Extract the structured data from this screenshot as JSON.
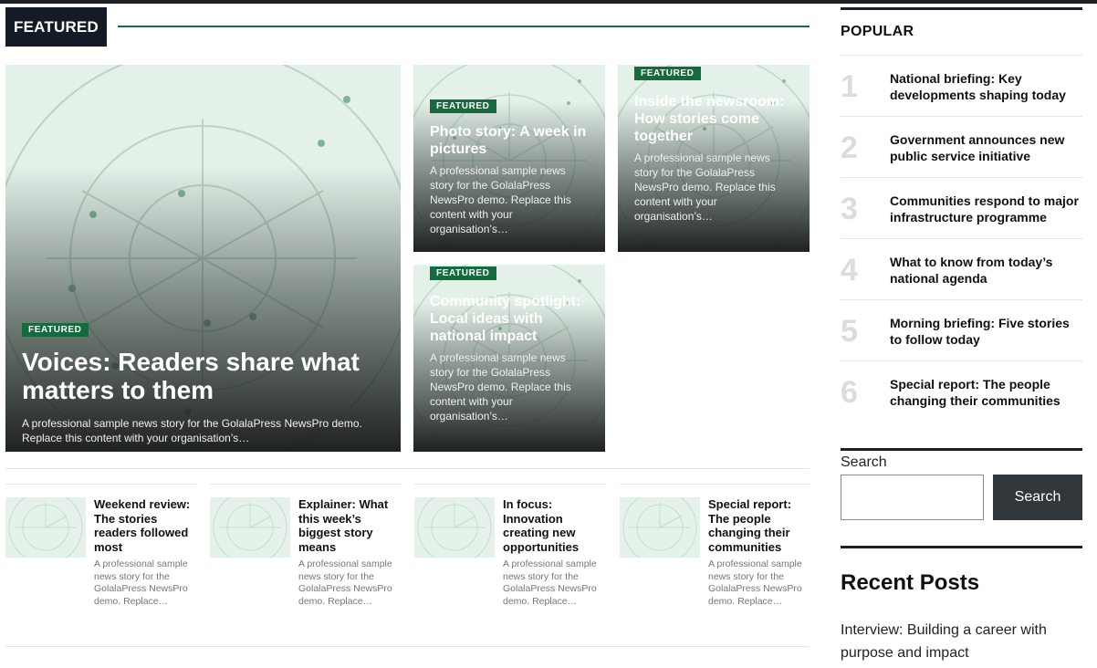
{
  "featured_section": {
    "label": "FEATURED"
  },
  "hero": {
    "badge": "FEATURED",
    "title": "Voices: Readers share what matters to them",
    "excerpt": "A professional sample news story for the GolalaPress NewsPro demo. Replace this content with your organisation’s…"
  },
  "cards": [
    {
      "badge": "FEATURED",
      "title": "Photo story: A week in pictures",
      "excerpt": "A professional sample news story for the GolalaPress NewsPro demo. Replace this content with your organisation’s…"
    },
    {
      "badge": "FEATURED",
      "title": "Inside the newsroom: How stories come together",
      "excerpt": "A professional sample news story for the GolalaPress NewsPro demo. Replace this content with your organisation’s…"
    },
    {
      "badge": "FEATURED",
      "title": "Community spotlight: Local ideas with national impact",
      "excerpt": "A professional sample news story for the GolalaPress NewsPro demo. Replace this content with your organisation’s…"
    }
  ],
  "mini_posts": [
    {
      "title": "Weekend review: The stories readers followed most",
      "excerpt": "A professional sample news story for the GolalaPress NewsPro demo. Replace…"
    },
    {
      "title": "Explainer: What this week’s biggest story means",
      "excerpt": "A professional sample news story for the GolalaPress NewsPro demo. Replace…"
    },
    {
      "title": "In focus: Innovation creating new opportunities",
      "excerpt": "A professional sample news story for the GolalaPress NewsPro demo. Replace…"
    },
    {
      "title": "Special report: The people changing their communities",
      "excerpt": "A professional sample news story for the GolalaPress NewsPro demo. Replace…"
    }
  ],
  "popular": {
    "title": "POPULAR",
    "items": [
      {
        "num": "1",
        "title": "National briefing: Key developments shaping today"
      },
      {
        "num": "2",
        "title": "Government announces new public service initiative"
      },
      {
        "num": "3",
        "title": "Communities respond to major infrastructure programme"
      },
      {
        "num": "4",
        "title": "What to know from today’s national agenda"
      },
      {
        "num": "5",
        "title": "Morning briefing: Five stories to follow today"
      },
      {
        "num": "6",
        "title": "Special report: The people changing their communities"
      }
    ]
  },
  "search": {
    "label": "Search",
    "button": "Search",
    "value": ""
  },
  "recent": {
    "title": "Recent Posts",
    "items": [
      "Interview: Building a career with purpose and impact"
    ]
  },
  "colors": {
    "accent": "#166b3e",
    "dark": "#151b26",
    "button": "#32373c",
    "art_bg": "#e6f1ea"
  }
}
